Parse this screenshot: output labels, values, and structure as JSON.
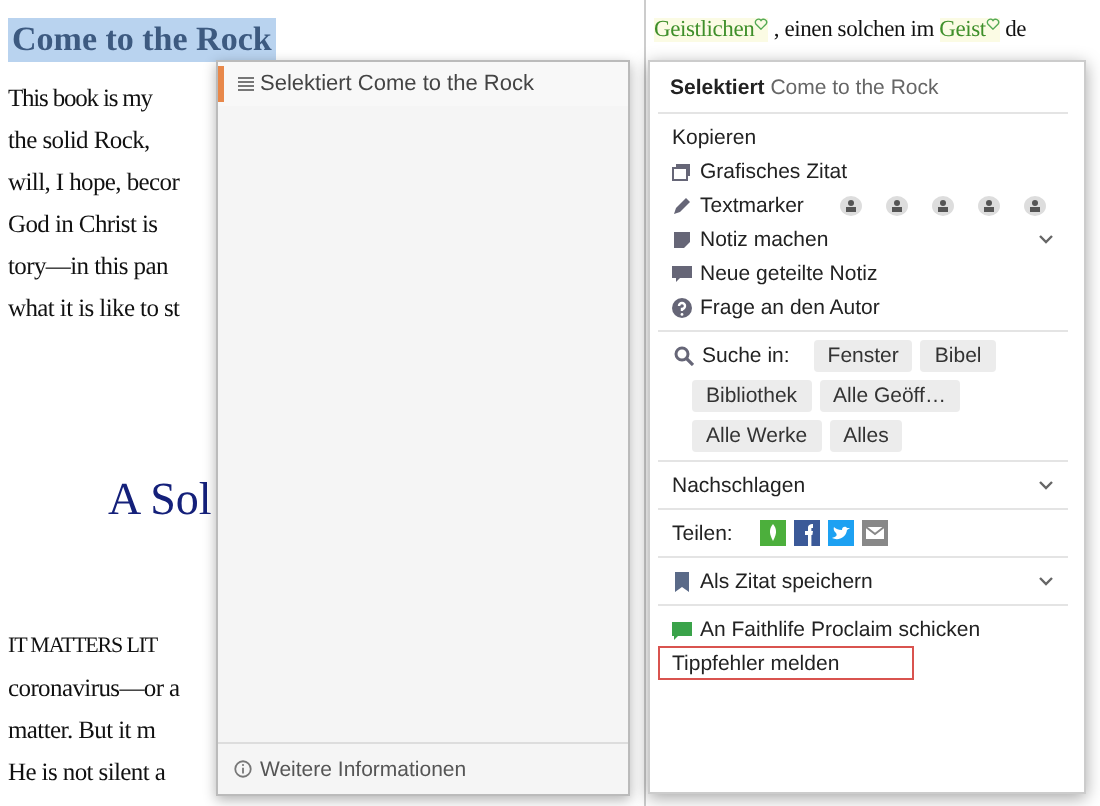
{
  "document": {
    "heading": {
      "text": "Come to the Rock",
      "selected": true
    },
    "intro_lines": [
      "This book is my",
      "the solid Rock,",
      "will, I hope, becor",
      "God in Christ is",
      "tory—in this pan",
      "what it is like to st"
    ],
    "section_title": "A Sol",
    "body_lines": [
      "IT MATTERS LIT",
      "coronavirus—or a",
      "matter. But it m",
      "He is not silent a"
    ]
  },
  "side_text": {
    "segments": [
      {
        "kind": "term",
        "text": "Geistlichen"
      },
      {
        "kind": "plain",
        "text": " , einen solchen im "
      },
      {
        "kind": "term",
        "text": "Geist"
      },
      {
        "kind": "plain",
        "text": " de"
      }
    ]
  },
  "popup": {
    "label": "Selektiert",
    "value": "Come to the Rock",
    "footer": "Weitere Informationen"
  },
  "menu": {
    "label": "Selektiert",
    "value": "Come to the Rock",
    "sections": [
      {
        "items": [
          {
            "kind": "copy",
            "label": "Kopieren"
          },
          {
            "kind": "graphic_quote",
            "label": "Grafisches Zitat"
          },
          {
            "kind": "highlighter",
            "label": "Textmarker"
          },
          {
            "kind": "note",
            "label": "Notiz machen",
            "expandable": true
          },
          {
            "kind": "shared_note",
            "label": "Neue geteilte Notiz"
          },
          {
            "kind": "question",
            "label": "Frage an den Autor"
          }
        ]
      },
      {
        "items": [
          {
            "kind": "search",
            "label": "Suche in:",
            "buttons": [
              "Fenster",
              "Bibel",
              "Bibliothek",
              "Alle Geöff…",
              "Alle Werke",
              "Alles"
            ]
          }
        ]
      },
      {
        "items": [
          {
            "kind": "lookup",
            "label": "Nachschlagen",
            "expandable": true
          }
        ]
      },
      {
        "items": [
          {
            "kind": "share",
            "label": "Teilen:"
          }
        ]
      },
      {
        "items": [
          {
            "kind": "save_quote",
            "label": "Als Zitat speichern",
            "expandable": true
          }
        ]
      },
      {
        "items": [
          {
            "kind": "proclaim",
            "label": "An Faithlife Proclaim schicken"
          },
          {
            "kind": "report",
            "label": "Tippfehler melden",
            "outlined": true
          }
        ]
      }
    ]
  }
}
